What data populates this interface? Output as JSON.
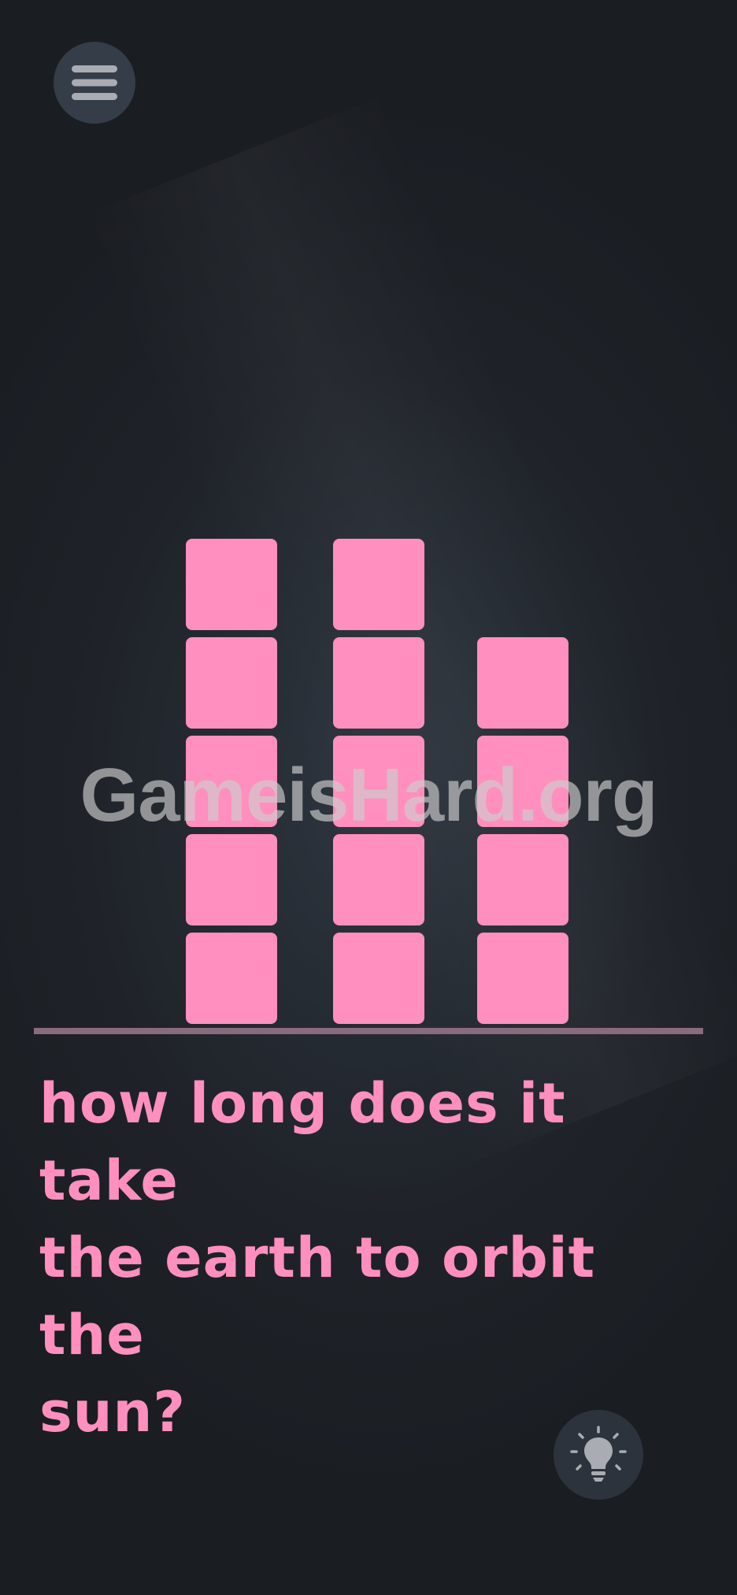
{
  "game": {
    "question": "how long does it take\nthe earth to orbit the\nsun?",
    "watermark": "GameisHard.org",
    "answer_columns": [
      5,
      5,
      4
    ]
  },
  "controls": {
    "menu_icon": "hamburger-menu-icon",
    "hint_icon": "lightbulb-icon"
  },
  "colors": {
    "background": "#1b1e23",
    "tile": "#ff8fbe",
    "question_text": "#ff8fbe",
    "ground_line": "#8a6a7d",
    "button_bg": "#353d48",
    "icon": "#a9adb3"
  }
}
